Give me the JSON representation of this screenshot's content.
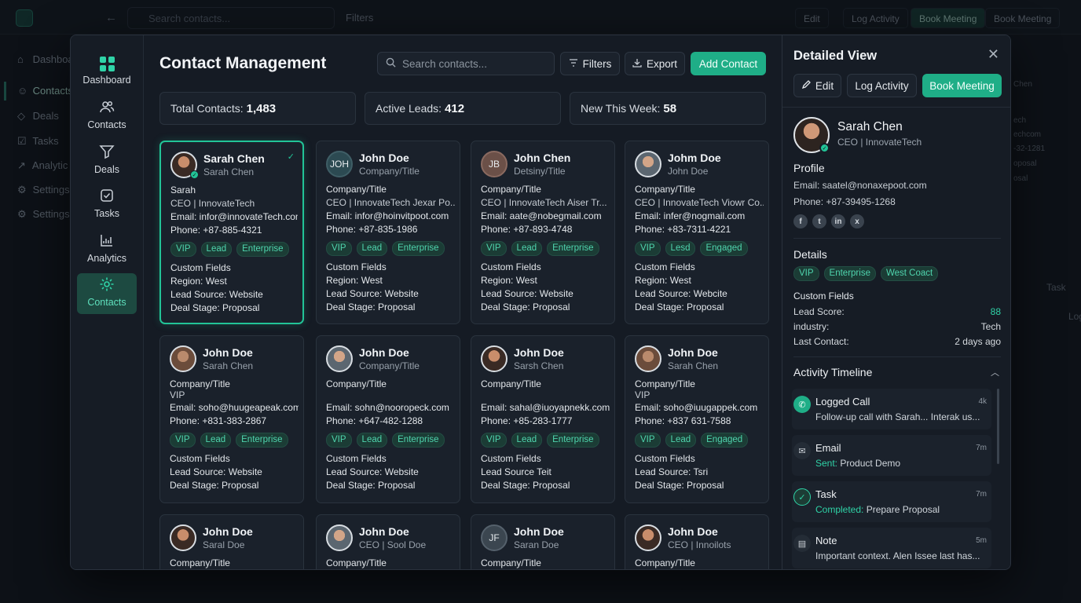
{
  "background": {
    "search_placeholder": "Search contacts...",
    "filters_label": "Filters",
    "buttons": [
      "Edit",
      "Log Activity",
      "Book Meeting",
      "Book Meeting"
    ],
    "sidebar": [
      "Dashboa",
      "Contacts",
      "Deals",
      "Tasks",
      "Analytic",
      "Settings",
      "Settings"
    ],
    "right_fragments": [
      "Chen",
      "ech",
      "echcom",
      "-32-1281",
      "oposal",
      "osal",
      "Task",
      "Log"
    ]
  },
  "sidebar": {
    "items": [
      {
        "label": "Dashboard",
        "icon": "dashboard-grid-icon"
      },
      {
        "label": "Contacts",
        "icon": "users-icon"
      },
      {
        "label": "Deals",
        "icon": "funnel-icon"
      },
      {
        "label": "Tasks",
        "icon": "checkbox-icon"
      },
      {
        "label": "Analytics",
        "icon": "chart-icon"
      },
      {
        "label": "Contacts",
        "icon": "gear-icon"
      }
    ],
    "active_index": 5
  },
  "header": {
    "title": "Contact Management",
    "search_placeholder": "Search contacts...",
    "filters_label": "Filters",
    "export_label": "Export",
    "add_label": "Add Contact"
  },
  "stats": [
    {
      "label": "Total Contacts:",
      "value": "1,483"
    },
    {
      "label": "Active Leads:",
      "value": "412"
    },
    {
      "label": "New This Week:",
      "value": "58"
    }
  ],
  "cards": [
    {
      "name": "Sarah Chen",
      "sub": "Sarah Chen",
      "avatar": "photo",
      "lines": [
        "Sarah",
        "CEO | InnovateTech",
        "Email: infor@innovateTech.com",
        "Phone: +87-885-4321"
      ],
      "tags": [
        "VIP",
        "Lead",
        "Enterprise"
      ],
      "custom": [
        "Custom Fields",
        "Region: West",
        "Lead Source: Website",
        "Deal Stage: Proposal"
      ]
    },
    {
      "name": "John Doe",
      "sub": "Company/Title",
      "avatar": "JOH",
      "lines": [
        "Company/Title",
        "CEO | InnovateTech Jexar Po...",
        "Email: infor@hoinvitpoot.com",
        "Phone: +87-835-1986"
      ],
      "tags": [
        "VIP",
        "Lead",
        "Enterprise"
      ],
      "custom": [
        "Custom Fields",
        "Region: West",
        "Lead Source: Website",
        "Deal Stage: Proposal"
      ]
    },
    {
      "name": "John Chen",
      "sub": "Detsiny/Title",
      "avatar": "JB",
      "lines": [
        "Company/Title",
        "CEO | InnovateTech Aiser Tr...",
        "Email: aate@nobegmail.com",
        "Phone: +87-893-4748"
      ],
      "tags": [
        "VIP",
        "Lead",
        "Enterprise"
      ],
      "custom": [
        "Custom Fields",
        "Region: West",
        "Lead Source: Website",
        "Deal Stage: Proposal"
      ]
    },
    {
      "name": "Johm Doe",
      "sub": "John Doe",
      "avatar": "photo",
      "lines": [
        "Company/Title",
        "CEO | InnovateTech Viowr Co...",
        "Email: infer@nogmail.com",
        "Phone: +83-7311-4221"
      ],
      "tags": [
        "VIP",
        "Lesd",
        "Engaged"
      ],
      "custom": [
        "Custom Fields",
        "Region: West",
        "Lead Source: Webcite",
        "Deal Stage: Proposal"
      ]
    },
    {
      "name": "John Doe",
      "sub": "Sarah Chen",
      "avatar": "photo",
      "lines": [
        "Company/Title",
        "VIP",
        "Email: soho@huugeapeak.com",
        "Phone: +831-383-2867"
      ],
      "tags": [
        "VIP",
        "Lead",
        "Enterprise"
      ],
      "custom": [
        "Custom Fields",
        "Lead Source: Website",
        "Deal Stage: Proposal"
      ]
    },
    {
      "name": "John Doe",
      "sub": "Company/Title",
      "avatar": "photo",
      "lines": [
        "Company/Title",
        "",
        "Email: sohn@nooropeck.com",
        "Phone: +647-482-1288"
      ],
      "tags": [
        "VIP",
        "Lead",
        "Enterprise"
      ],
      "custom": [
        "Custom Fields",
        "Lead Source: Website",
        "Deal Stage: Proposal"
      ]
    },
    {
      "name": "John Doe",
      "sub": "Sarsh Chen",
      "avatar": "photo",
      "lines": [
        "Company/Title",
        "",
        "Email: sahal@iuoyapnekk.com",
        "Phone: +85-283-1777"
      ],
      "tags": [
        "VIP",
        "Lead",
        "Enterprise"
      ],
      "custom": [
        "Custom Fields",
        "Lead Source Teit",
        "Deal Stage: Proposal"
      ]
    },
    {
      "name": "John Doe",
      "sub": "Sarah Chen",
      "avatar": "photo",
      "lines": [
        "Company/Title",
        "VIP",
        "Email: soho@iuugappek.com",
        "Phone: +837 631-7588"
      ],
      "tags": [
        "VIP",
        "Lead",
        "Engaged"
      ],
      "custom": [
        "Custom Fields",
        "Lead Source: Tsri",
        "Deal Stage: Proposal"
      ]
    },
    {
      "name": "John Doe",
      "sub": "Saral Doe",
      "avatar": "photo",
      "lines": [
        "Company/Title"
      ],
      "tags": [],
      "custom": []
    },
    {
      "name": "John Doe",
      "sub": "CEO | Sool Doe",
      "avatar": "photo",
      "lines": [
        "Company/Title"
      ],
      "tags": [],
      "custom": []
    },
    {
      "name": "John Doe",
      "sub": "Saran Doe",
      "avatar": "JF",
      "lines": [
        "Company/Title"
      ],
      "tags": [],
      "custom": []
    },
    {
      "name": "John Doe",
      "sub": "CEO | Innoilots",
      "avatar": "photo",
      "lines": [
        "Company/Title"
      ],
      "tags": [],
      "custom": []
    }
  ],
  "detail": {
    "title": "Detailed View",
    "edit_label": "Edit",
    "log_label": "Log Activity",
    "book_label": "Book Meeting",
    "name": "Sarah Chen",
    "role": "CEO | InnovateTech",
    "profile_heading": "Profile",
    "email": "Email: saatel@nonaxepoot.com",
    "phone": "Phone: +87-39495-1268",
    "socials": [
      "f",
      "t",
      "in",
      "x"
    ],
    "details_heading": "Details",
    "tags": [
      "VIP",
      "Enterprise",
      "West Coact"
    ],
    "custom_heading": "Custom Fields",
    "fields": [
      {
        "key": "Lead Score:",
        "value": "88"
      },
      {
        "key": "industry:",
        "value": "Tech"
      },
      {
        "key": "Last Contact:",
        "value": "2 days ago"
      }
    ],
    "timeline_heading": "Activity Timeline",
    "timeline": [
      {
        "icon": "phone-icon",
        "title": "Logged Call",
        "prefix": "",
        "desc": "Follow-up call with Sarah... Interak us...",
        "time": "4k"
      },
      {
        "icon": "mail-icon",
        "title": "Email",
        "prefix": "Sent:",
        "desc": " Product Demo",
        "time": "7m"
      },
      {
        "icon": "task-check-icon",
        "title": "Task",
        "prefix": "Completed:",
        "desc": " Prepare Proposal",
        "time": "7m"
      },
      {
        "icon": "note-icon",
        "title": "Note",
        "prefix": "",
        "desc": "Important context. Alen Issee last has...",
        "time": "5m"
      }
    ]
  },
  "colors": {
    "accent": "#1fae87",
    "accent_text": "#2fd3a7",
    "bg": "#0d1117",
    "panel": "#151b24"
  }
}
